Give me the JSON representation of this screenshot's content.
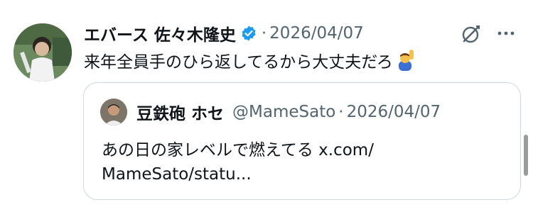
{
  "tweet": {
    "author_name": "エバース 佐々木隆史",
    "verified": true,
    "separator": "·",
    "date": "2026/04/07",
    "text": "来年全員手のひら返してるから大丈夫だろ",
    "emoji": "man-raising-hand-emoji"
  },
  "quoted_tweet": {
    "author_name": "豆鉄砲 ホセ",
    "handle": "@MameSato",
    "separator": "·",
    "date": "2026/04/07",
    "text_line1": "あの日の家レベルで燃えてる x.com/",
    "text_line2": "MameSato/statu..."
  },
  "icons": {
    "grok": "grok-icon",
    "more": "more-icon",
    "verified": "verified-badge-icon"
  },
  "colors": {
    "verified_blue": "#1d9bf0",
    "secondary_text": "#536471",
    "border": "#cfd9de"
  }
}
